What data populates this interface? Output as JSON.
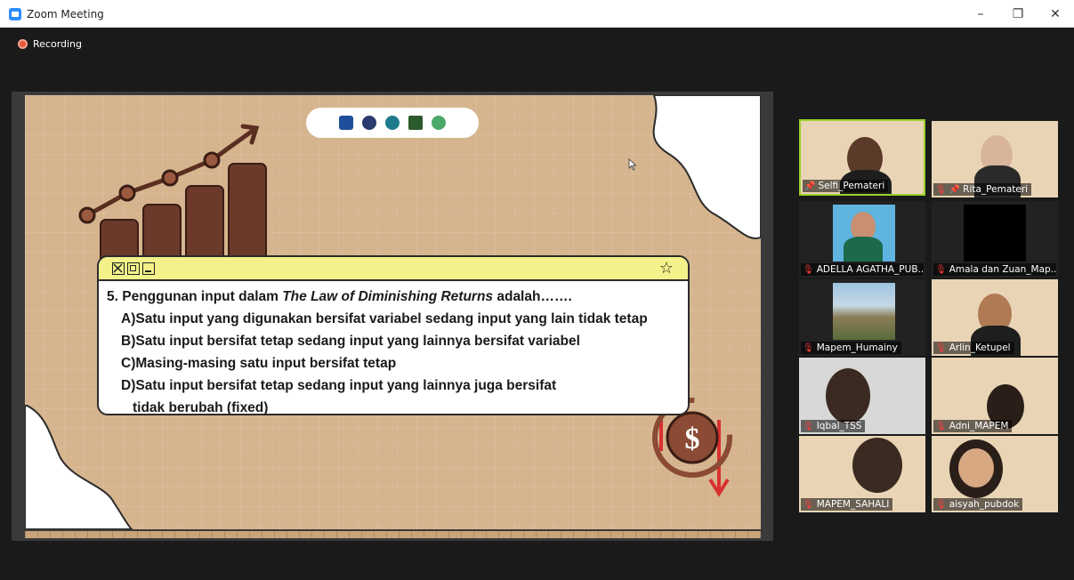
{
  "window": {
    "title": "Zoom Meeting",
    "controls": {
      "minimize": "–",
      "restore": "❐",
      "close": "✕"
    }
  },
  "recording": {
    "label": "Recording"
  },
  "slide": {
    "question": {
      "prefix": "5. Penggunan input dalam ",
      "italic": "The Law of Diminishing Returns",
      "suffix": " adalah……."
    },
    "options": [
      "A)Satu input yang digunakan bersifat variabel sedang input yang lain tidak tetap",
      "B)Satu input bersifat tetap sedang input yang lainnya bersifat variabel",
      "C)Masing-masing satu input bersifat tetap",
      "D)Satu input bersifat tetap sedang input yang lainnya juga bersifat"
    ],
    "option_continuation": "tidak berubah (fixed)",
    "colors": {
      "background": "#d5b48e",
      "header": "#f3f28a",
      "bars": "#6b3a2a"
    }
  },
  "participants": [
    {
      "name": "Selfi_Pemateri",
      "pinned": true,
      "muted": false,
      "active": true
    },
    {
      "name": "Rita_Pemateri",
      "pinned": true,
      "muted": true,
      "active": false
    },
    {
      "name": "ADELLA AGATHA_PUB...",
      "pinned": false,
      "muted": true,
      "active": false
    },
    {
      "name": "Amala dan Zuan_Map...",
      "pinned": false,
      "muted": true,
      "active": false
    },
    {
      "name": "Mapem_Humainy",
      "pinned": false,
      "muted": true,
      "active": false
    },
    {
      "name": "Arlin_Ketupel",
      "pinned": false,
      "muted": true,
      "active": false
    },
    {
      "name": "Iqbal_TSS",
      "pinned": false,
      "muted": true,
      "active": false
    },
    {
      "name": "Adni_MAPEM",
      "pinned": false,
      "muted": true,
      "active": false
    },
    {
      "name": "MAPEM_SAHALI",
      "pinned": false,
      "muted": true,
      "active": false
    },
    {
      "name": "aisyah_pubdok",
      "pinned": false,
      "muted": true,
      "active": false
    }
  ]
}
